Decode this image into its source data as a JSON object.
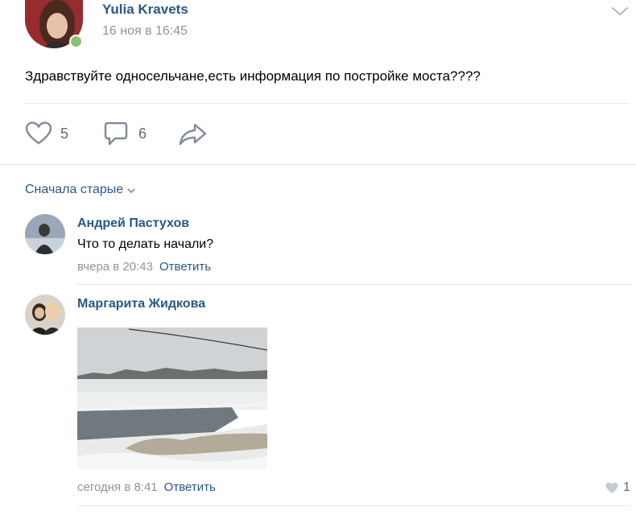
{
  "post": {
    "author": "Yulia Kravets",
    "time": "16 ноя в 16:45",
    "text": "Здравствуйте односельчане,есть информация по постройке моста????",
    "likes": "5",
    "comments": "6"
  },
  "comments_sort": "Сначала старые",
  "comments": [
    {
      "author": "Андрей Пастухов",
      "text": "Что то делать начали?",
      "time": "вчера в 20:43",
      "reply_label": "Ответить"
    },
    {
      "author": "Маргарита Жидкова",
      "time": "сегодня в 8:41",
      "reply_label": "Ответить",
      "likes": "1"
    }
  ],
  "colors": {
    "link": "#2a5885",
    "muted": "#939393",
    "icon": "#828a99",
    "online": "#8ac176"
  }
}
